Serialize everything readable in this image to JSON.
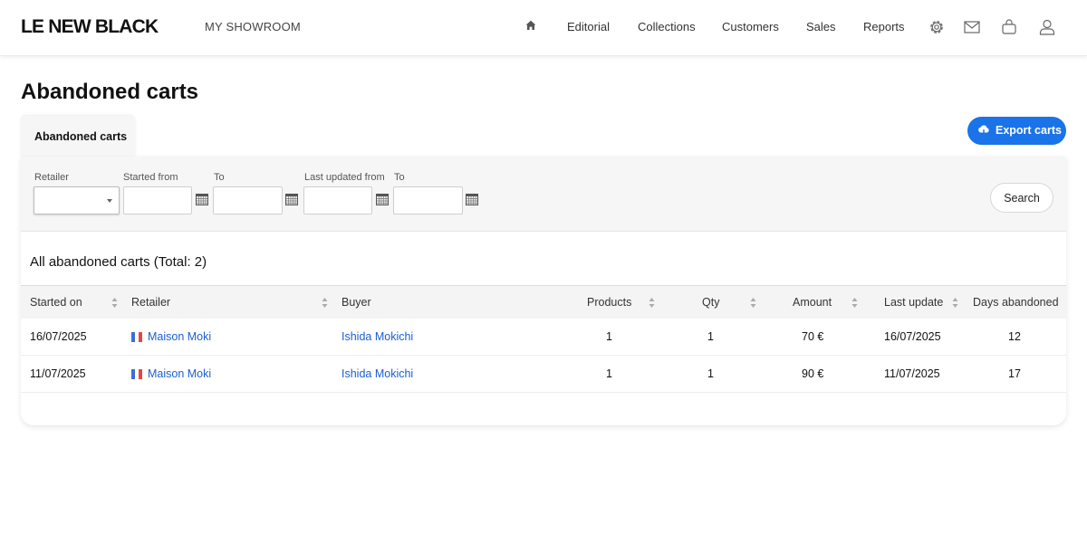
{
  "header": {
    "logo": "LE NEW BLACK",
    "showroom": "MY SHOWROOM",
    "nav": [
      "Editorial",
      "Collections",
      "Customers",
      "Sales",
      "Reports"
    ]
  },
  "page": {
    "title": "Abandoned carts",
    "tab": "Abandoned carts",
    "export_label": "Export carts"
  },
  "filters": {
    "retailer_label": "Retailer",
    "started_from_label": "Started from",
    "started_to_label": "To",
    "updated_from_label": "Last updated from",
    "updated_to_label": "To",
    "search_label": "Search"
  },
  "table": {
    "total_label": "All abandoned carts (Total: 2)",
    "columns": [
      "Started on",
      "Retailer",
      "Buyer",
      "Products",
      "Qty",
      "Amount",
      "Last update",
      "Days abandoned"
    ],
    "rows": [
      {
        "started": "16/07/2025",
        "retailer": "Maison Moki",
        "buyer": "Ishida Mokichi",
        "products": "1",
        "qty": "1",
        "amount": "70 €",
        "last_update": "16/07/2025",
        "days": "12"
      },
      {
        "started": "11/07/2025",
        "retailer": "Maison Moki",
        "buyer": "Ishida Mokichi",
        "products": "1",
        "qty": "1",
        "amount": "90 €",
        "last_update": "11/07/2025",
        "days": "17"
      }
    ]
  },
  "colors": {
    "accent": "#1a73e8",
    "link": "#1a5fd0"
  },
  "icons": [
    "home-icon",
    "gear-icon",
    "mail-icon",
    "bag-icon",
    "user-icon",
    "download-cloud-icon",
    "calendar-icon",
    "sort-icon",
    "flag-fr-icon"
  ]
}
